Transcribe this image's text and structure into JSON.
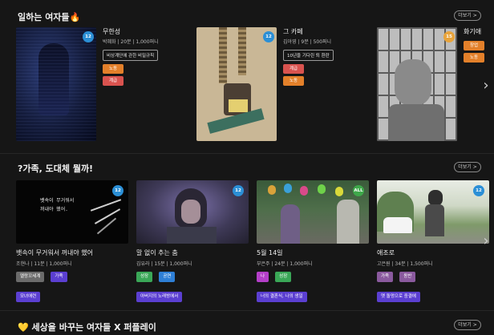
{
  "sections": [
    {
      "title": "일하는 여자들🔥",
      "more": "더보기 >",
      "cards": [
        {
          "title": "무한성",
          "meta": "박혜화 | 20분 | 1,000퍼니",
          "badge": "12",
          "pill": "비상계단에 관한 비밀규칙",
          "tags": [
            "노동",
            "계급"
          ]
        },
        {
          "title": "그 카페",
          "meta": "김아영 | 9분 | 500퍼니",
          "badge": "12",
          "pill": "10년을 기다린 퇴 환란",
          "tags": [
            "계급",
            "노동"
          ]
        },
        {
          "title": "화기애",
          "meta": "",
          "badge": "15",
          "pill": "",
          "tags": [
            "창업",
            "노동"
          ]
        }
      ]
    },
    {
      "title": "?가족, 도대체 뭘까!",
      "more": "더보기 >",
      "cards": [
        {
          "title": "뱃속이 무거워서 꺼내야 했어",
          "meta": "조현나 | 11분 | 1,000퍼니",
          "badge": "12",
          "subtitle1": "뱃속이 무거워서",
          "subtitle2": "꺼내야 했어.",
          "tags": [
            "멜랑꼬세계",
            "가족"
          ],
          "tags2": [
            "모녀애련"
          ]
        },
        {
          "title": "말 없이 추는 춤",
          "meta": "김유라 | 15분 | 1,000퍼니",
          "badge": "12",
          "tags": [
            "성장",
            "공연"
          ],
          "tags2": [
            "아버지의 노래방에서"
          ]
        },
        {
          "title": "5월 14일",
          "meta": "부은주 | 24분 | 1,000퍼니",
          "badge": "ALL",
          "tags": [
            "나",
            "성장"
          ],
          "tags2": [
            "너의 결혼식, 나의 생일"
          ]
        },
        {
          "title": "애조로",
          "meta": "고은원 | 34분 | 1,500퍼니",
          "badge": "12",
          "tags": [
            "가족",
            "동반"
          ],
          "tags2": [
            "옛 돌멍으로 중결에"
          ]
        }
      ]
    },
    {
      "title": "💛 세상을 바꾸는 여자들 X 퍼플레이",
      "more": "더보기 >"
    }
  ],
  "colors": {
    "background": "#161616",
    "badge_blue": "#2b8fd6",
    "badge_orange": "#e8a33a",
    "badge_green": "#3ea84a",
    "tag_gray": "#6b6b6b",
    "tag_red": "#d9534f",
    "tag_orange": "#e3802a",
    "tag_purple": "#5b3fd1",
    "tag_green": "#3aa757",
    "tag_magenta": "#b43fc9",
    "tag_teal": "#2e9c8f"
  },
  "icons": {
    "next": "chevron-right-icon"
  }
}
